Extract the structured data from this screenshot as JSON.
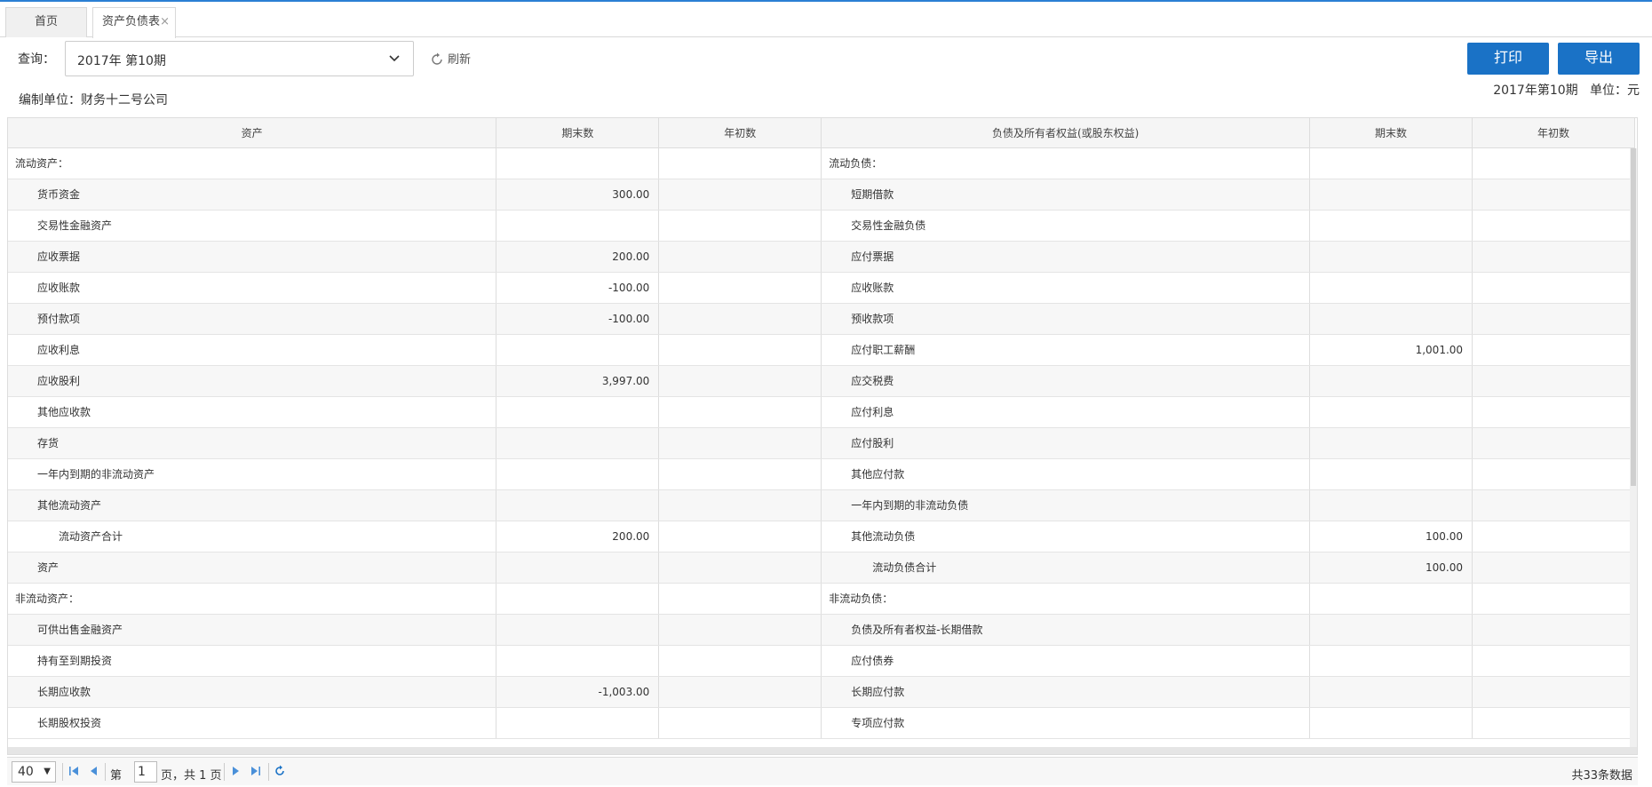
{
  "tabs": {
    "home": "首页",
    "active": "资产负债表",
    "close": "×"
  },
  "query": {
    "label": "查询：",
    "selected": "2017年 第10期",
    "refresh": "刷新"
  },
  "buttons": {
    "print": "打印",
    "export": "导出"
  },
  "header_info": {
    "unit": "编制单位：财务十二号公司",
    "period": "2017年第10期",
    "currency": "单位：元"
  },
  "columns": [
    "资产",
    "期末数",
    "年初数",
    "负债及所有者权益(或股东权益)",
    "期末数",
    "年初数"
  ],
  "rows": [
    {
      "a": "流动资产：",
      "ai": 0,
      "ae": "",
      "ab": "",
      "l": "流动负债：",
      "li": 0,
      "le": "",
      "lb": ""
    },
    {
      "a": "货币资金",
      "ai": 1,
      "ae": "300.00",
      "ab": "",
      "l": "短期借款",
      "li": 1,
      "le": "",
      "lb": ""
    },
    {
      "a": "交易性金融资产",
      "ai": 1,
      "ae": "",
      "ab": "",
      "l": "交易性金融负债",
      "li": 1,
      "le": "",
      "lb": ""
    },
    {
      "a": "应收票据",
      "ai": 1,
      "ae": "200.00",
      "ab": "",
      "l": "应付票据",
      "li": 1,
      "le": "",
      "lb": ""
    },
    {
      "a": "应收账款",
      "ai": 1,
      "ae": "-100.00",
      "ab": "",
      "l": "应收账款",
      "li": 1,
      "le": "",
      "lb": ""
    },
    {
      "a": "预付款项",
      "ai": 1,
      "ae": "-100.00",
      "ab": "",
      "l": "预收款项",
      "li": 1,
      "le": "",
      "lb": ""
    },
    {
      "a": "应收利息",
      "ai": 1,
      "ae": "",
      "ab": "",
      "l": "应付职工薪酬",
      "li": 1,
      "le": "1,001.00",
      "lb": ""
    },
    {
      "a": "应收股利",
      "ai": 1,
      "ae": "3,997.00",
      "ab": "",
      "l": "应交税费",
      "li": 1,
      "le": "",
      "lb": ""
    },
    {
      "a": "其他应收款",
      "ai": 1,
      "ae": "",
      "ab": "",
      "l": "应付利息",
      "li": 1,
      "le": "",
      "lb": ""
    },
    {
      "a": "存货",
      "ai": 1,
      "ae": "",
      "ab": "",
      "l": "应付股利",
      "li": 1,
      "le": "",
      "lb": ""
    },
    {
      "a": "一年内到期的非流动资产",
      "ai": 1,
      "ae": "",
      "ab": "",
      "l": "其他应付款",
      "li": 1,
      "le": "",
      "lb": ""
    },
    {
      "a": "其他流动资产",
      "ai": 1,
      "ae": "",
      "ab": "",
      "l": "一年内到期的非流动负债",
      "li": 1,
      "le": "",
      "lb": ""
    },
    {
      "a": "流动资产合计",
      "ai": 2,
      "ae": "200.00",
      "ab": "",
      "l": "其他流动负债",
      "li": 1,
      "le": "100.00",
      "lb": ""
    },
    {
      "a": "资产",
      "ai": 1,
      "ae": "",
      "ab": "",
      "l": "流动负债合计",
      "li": 2,
      "le": "100.00",
      "lb": ""
    },
    {
      "a": "非流动资产：",
      "ai": 0,
      "ae": "",
      "ab": "",
      "l": "非流动负债：",
      "li": 0,
      "le": "",
      "lb": ""
    },
    {
      "a": "可供出售金融资产",
      "ai": 1,
      "ae": "",
      "ab": "",
      "l": "负债及所有者权益-长期借款",
      "li": 1,
      "le": "",
      "lb": ""
    },
    {
      "a": "持有至到期投资",
      "ai": 1,
      "ae": "",
      "ab": "",
      "l": "应付债券",
      "li": 1,
      "le": "",
      "lb": ""
    },
    {
      "a": "长期应收款",
      "ai": 1,
      "ae": "-1,003.00",
      "ab": "",
      "l": "长期应付款",
      "li": 1,
      "le": "",
      "lb": ""
    },
    {
      "a": "长期股权投资",
      "ai": 1,
      "ae": "",
      "ab": "",
      "l": "专项应付款",
      "li": 1,
      "le": "",
      "lb": ""
    }
  ],
  "pager": {
    "page_size": "40",
    "page_prefix": "第",
    "page_input": "1",
    "page_suffix": "页，共 1 页",
    "total": "共33条数据"
  }
}
